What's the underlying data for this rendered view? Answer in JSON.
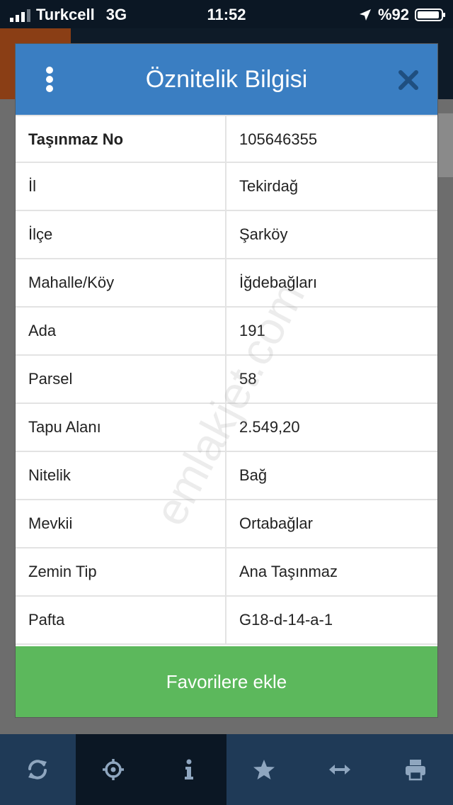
{
  "status_bar": {
    "carrier": "Turkcell",
    "network": "3G",
    "time": "11:52",
    "battery": "%92"
  },
  "modal": {
    "title": "Öznitelik Bilgisi",
    "rows": [
      {
        "key": "Taşınmaz No",
        "value": "105646355"
      },
      {
        "key": "İl",
        "value": "Tekirdağ"
      },
      {
        "key": "İlçe",
        "value": "Şarköy"
      },
      {
        "key": "Mahalle/Köy",
        "value": "İğdebağları"
      },
      {
        "key": "Ada",
        "value": "191"
      },
      {
        "key": "Parsel",
        "value": "58"
      },
      {
        "key": "Tapu Alanı",
        "value": "2.549,20"
      },
      {
        "key": "Nitelik",
        "value": "Bağ"
      },
      {
        "key": "Mevkii",
        "value": "Ortabağlar"
      },
      {
        "key": "Zemin Tip",
        "value": "Ana Taşınmaz"
      },
      {
        "key": "Pafta",
        "value": "G18-d-14-a-1"
      }
    ],
    "favorite_label": "Favorilere ekle"
  },
  "watermark": "emlakjet.com",
  "toolbar": {
    "items": [
      {
        "icon": "refresh-icon"
      },
      {
        "icon": "locate-icon"
      },
      {
        "icon": "info-icon"
      },
      {
        "icon": "star-icon"
      },
      {
        "icon": "measure-arrows-icon"
      },
      {
        "icon": "print-icon"
      }
    ]
  },
  "colors": {
    "header_blue": "#3a7ec2",
    "favorite_green": "#5cb85c",
    "toolbar_blue": "#1f3a57",
    "dark": "#0b1724"
  }
}
